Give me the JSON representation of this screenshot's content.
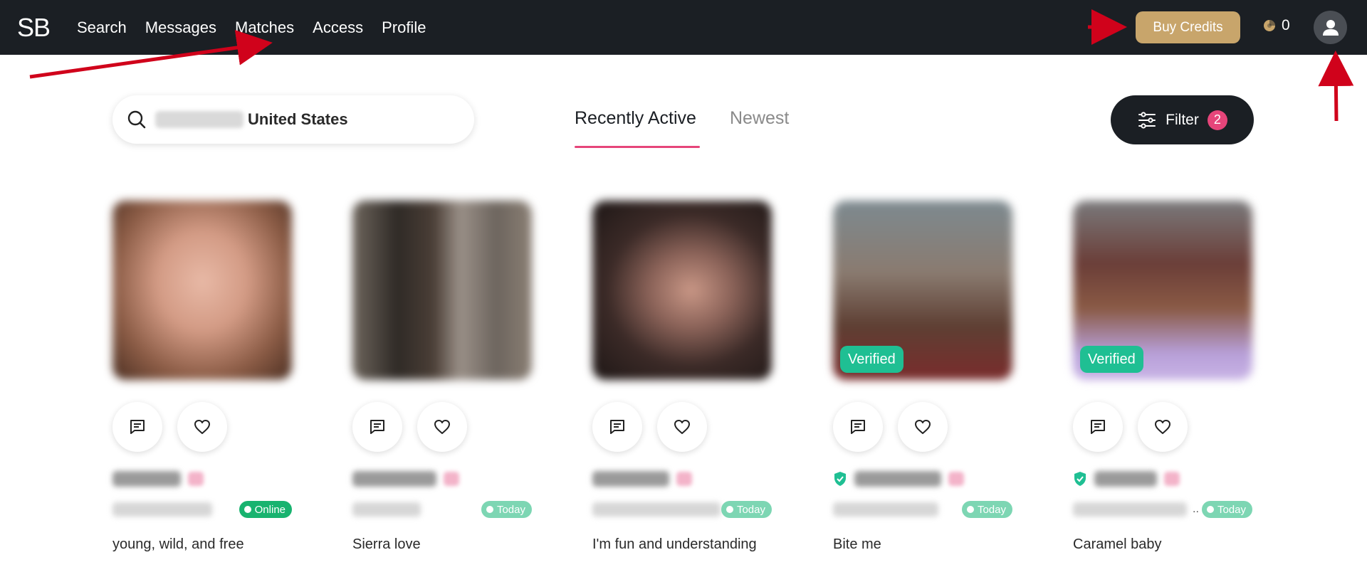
{
  "app": {
    "logo": "SB"
  },
  "nav": {
    "items": [
      "Search",
      "Messages",
      "Matches",
      "Access",
      "Profile"
    ]
  },
  "header": {
    "buy_credits_label": "Buy Credits",
    "credits_count": "0"
  },
  "search": {
    "country": "United States"
  },
  "tabs": {
    "active": "Recently Active",
    "inactive": "Newest"
  },
  "filter": {
    "label": "Filter",
    "count": "2"
  },
  "colors": {
    "accent_pink": "#e6457a",
    "gold": "#c8a56b",
    "verified_green": "#1fbf93",
    "online_green": "#18b36f",
    "today_green": "#7dd6b3",
    "nav_bg": "#1b1f24"
  },
  "cards": [
    {
      "verified": false,
      "status": "Online",
      "tagline": "young, wild, and free"
    },
    {
      "verified": false,
      "status": "Today",
      "tagline": "Sierra love"
    },
    {
      "verified": false,
      "status": "Today",
      "tagline": "I'm fun and understanding"
    },
    {
      "verified": true,
      "verified_label": "Verified",
      "status": "Today",
      "tagline": "Bite me"
    },
    {
      "verified": true,
      "verified_label": "Verified",
      "status": "Today",
      "tagline": "Caramel baby"
    }
  ]
}
